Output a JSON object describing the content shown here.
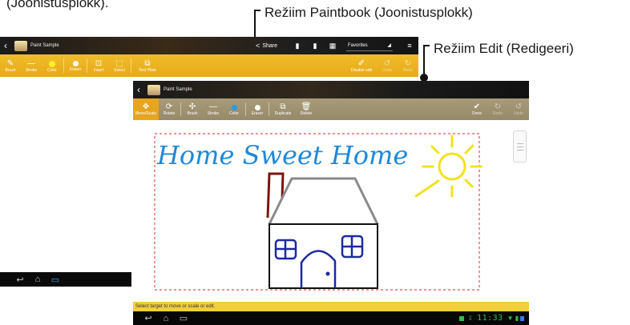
{
  "caption_top_cut": "(Joonistusplokk).",
  "callouts": {
    "paintbook_mode": "Režiim Paintbook (Joonistusplokk)",
    "edit_mode": "Režiim Edit (Redigeeri)"
  },
  "paintbook_screen": {
    "title": "Paint Sample",
    "share_label": "Share",
    "favorites_label": "Favorites",
    "tools": [
      "Brush",
      "Stroke",
      "Color",
      "Eraser",
      "Insert",
      "Select",
      "Text Plate"
    ],
    "right_tools": [
      "Disable edit",
      "Undo",
      "Redo"
    ]
  },
  "edit_screen": {
    "title": "Paint Sample",
    "tools": [
      "Move/Scale",
      "Rotate",
      "Brush",
      "Stroke",
      "Color",
      "Eraser",
      "Duplicate",
      "Delete"
    ],
    "right_tools": [
      "Done",
      "Redo",
      "Undo"
    ],
    "drawing_text": "Home Sweet Home",
    "status_message": "Select target to move or scale or edit.",
    "clock": "11:33"
  },
  "colors": {
    "paintbook_toolbar": "#ECB320",
    "edit_toolbar": "#A09370",
    "status_strip": "#F0CF3A",
    "ink_blue": "#1e88d8",
    "sun_yellow": "#f2e21b",
    "chimney_red": "#7a1512",
    "roof_gray": "#8a8a8a"
  },
  "icons": {
    "back": "back-arrow-icon",
    "home": "home-icon",
    "recent_apps": "recent-apps-icon",
    "share": "share-icon",
    "menu": "menu-icon"
  }
}
